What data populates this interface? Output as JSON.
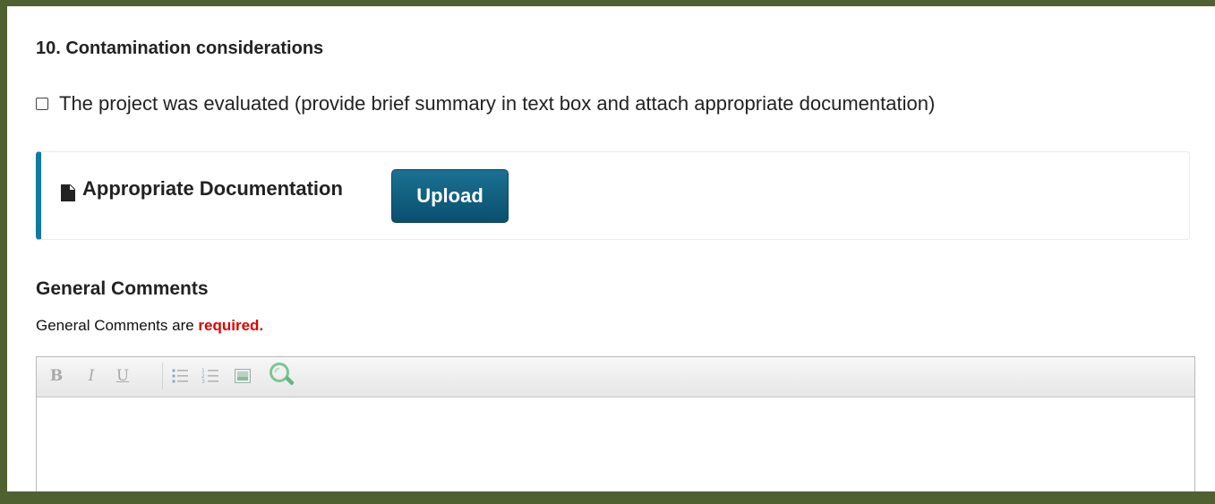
{
  "section": {
    "title": "10. Contamination considerations",
    "checkbox_label": "The project was evaluated (provide brief summary in text box and attach appropriate documentation)",
    "checked": false
  },
  "documentation": {
    "label": "Appropriate Documentation",
    "upload_label": "Upload",
    "icon": "file-icon",
    "accent_color": "#1079a6"
  },
  "comments": {
    "heading": "General Comments",
    "note_prefix": "General Comments are",
    "note_required": "required.",
    "required_color": "#e00000",
    "value": ""
  },
  "toolbar": {
    "bold_label": "B",
    "italic_label": "I",
    "underline_label": "U",
    "icons": [
      "bold-icon",
      "italic-icon",
      "underline-icon",
      "bulleted-list-icon",
      "numbered-list-icon",
      "image-icon",
      "zoom-icon"
    ]
  },
  "colors": {
    "frame": "#4f6131",
    "button": "#0a4f6e"
  }
}
